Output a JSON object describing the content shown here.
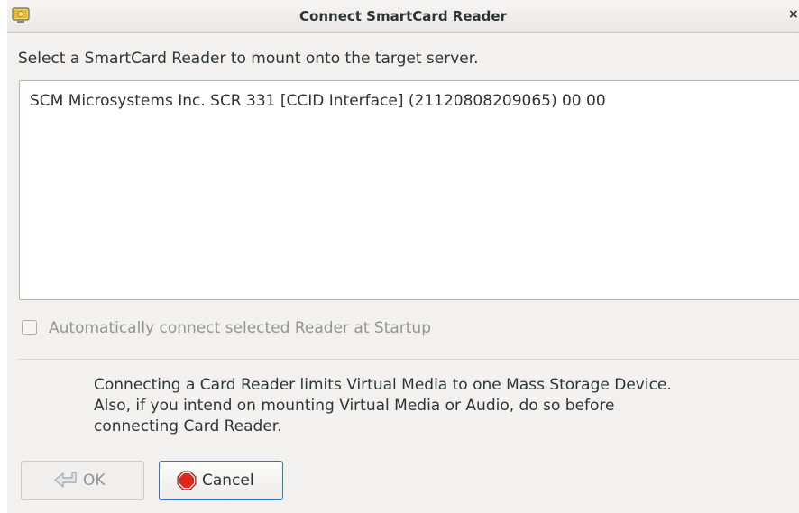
{
  "window": {
    "title": "Connect SmartCard Reader",
    "close_glyph": "×",
    "icon": "app-monitor-icon"
  },
  "prompt": "Select a SmartCard Reader to mount onto the target server.",
  "readers": [
    "SCM Microsystems Inc. SCR 331 [CCID Interface] (21120808209065) 00 00"
  ],
  "auto_connect": {
    "label": "Automatically connect selected Reader at Startup",
    "checked": false,
    "enabled": false
  },
  "note": {
    "lines": [
      "Connecting a Card Reader limits Virtual Media to one Mass Storage Device.",
      "Also, if you intend on mounting Virtual Media or Audio, do so before",
      "connecting Card Reader."
    ]
  },
  "buttons": {
    "ok": {
      "label": "OK",
      "icon": "ok-return-icon",
      "enabled": false
    },
    "cancel": {
      "label": "Cancel",
      "icon": "stop-icon",
      "enabled": true
    }
  },
  "colors": {
    "dialog_bg": "#f2f1f0",
    "focus_border": "#2f77c7",
    "stop_red": "#e0271a",
    "disabled_text": "#939595"
  }
}
